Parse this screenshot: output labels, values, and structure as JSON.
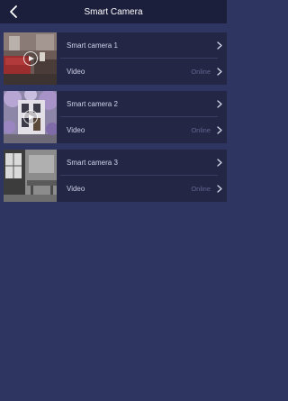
{
  "header": {
    "title": "Smart Camera",
    "back_icon": "chevron-left-icon"
  },
  "cameras": [
    {
      "name": "Smart camera 1",
      "video_label": "Video",
      "status": "Online"
    },
    {
      "name": "Smart camera 2",
      "video_label": "Video",
      "status": "Online"
    },
    {
      "name": "Smart camera 3",
      "video_label": "Video",
      "status": "Online"
    }
  ],
  "colors": {
    "background": "#2f3561",
    "card": "#242646",
    "nav": "#1c1f3c",
    "status_text": "#60658f"
  }
}
